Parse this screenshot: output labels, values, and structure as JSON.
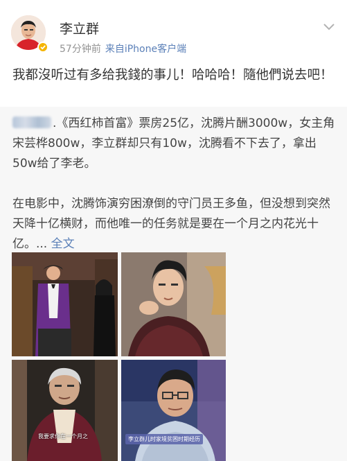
{
  "header": {
    "user_name": "李立群",
    "time": "57分钟前",
    "source": "来自iPhone客户端"
  },
  "post": {
    "text": "我都沒听过有多给我錢的事儿！哈哈哈！隨他們说去吧！"
  },
  "repost": {
    "para1": ".《西红柿首富》票房25亿，沈腾片酬3000w，女主角宋芸桦800w，李立群却只有10w，沈腾看不下去了，拿出50w给了李老。",
    "para2": "在电影中，沈腾饰演穷困潦倒的守门员王多鱼，但没想到突然天降十亿横财，而他唯一的任务就是要在一个月之内花光十亿。... ",
    "full_text_link": "全文"
  },
  "photos": [
    {
      "caption": ""
    },
    {
      "caption": ""
    },
    {
      "caption": "我要求你在一个月之"
    },
    {
      "caption": "李立群儿时家境贫困时期经历"
    }
  ],
  "colors": {
    "link": "#5b80b8",
    "meta": "#939393",
    "repost_bg": "#f7f7f7"
  },
  "icons": [
    "avatar",
    "verified-badge-icon",
    "chevron-down-icon"
  ]
}
